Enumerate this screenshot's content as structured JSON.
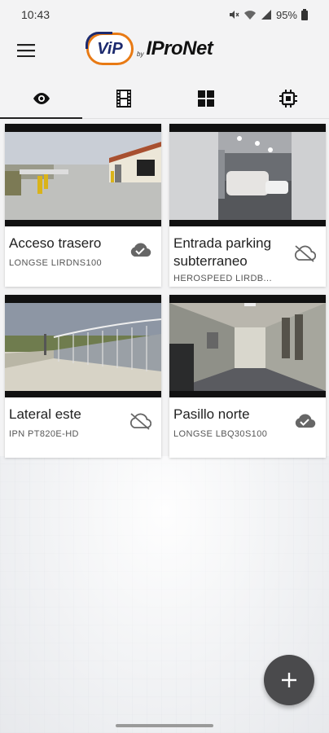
{
  "status_bar": {
    "time": "10:43",
    "battery": "95%"
  },
  "app_bar": {
    "logo_vip": "ViP",
    "logo_by": "by",
    "logo_brand": "IProNet"
  },
  "tabs": [
    {
      "icon": "eye-icon",
      "active": true
    },
    {
      "icon": "film-icon",
      "active": false
    },
    {
      "icon": "grid-icon",
      "active": false
    },
    {
      "icon": "chip-icon",
      "active": false
    }
  ],
  "cameras": [
    {
      "name": "Acceso trasero",
      "model": "LONGSE LIRDNS100",
      "cloud": "connected"
    },
    {
      "name": "Entrada parking subterraneo",
      "model": "HEROSPEED LIRDB...",
      "cloud": "disconnected"
    },
    {
      "name": "Lateral este",
      "model": "IPN PT820E-HD",
      "cloud": "disconnected"
    },
    {
      "name": "Pasillo norte",
      "model": "LONGSE LBQ30S100",
      "cloud": "connected"
    }
  ],
  "colors": {
    "accent_orange": "#e87a14",
    "brand_navy": "#1c2a6e",
    "fab": "#4a4a4c"
  }
}
